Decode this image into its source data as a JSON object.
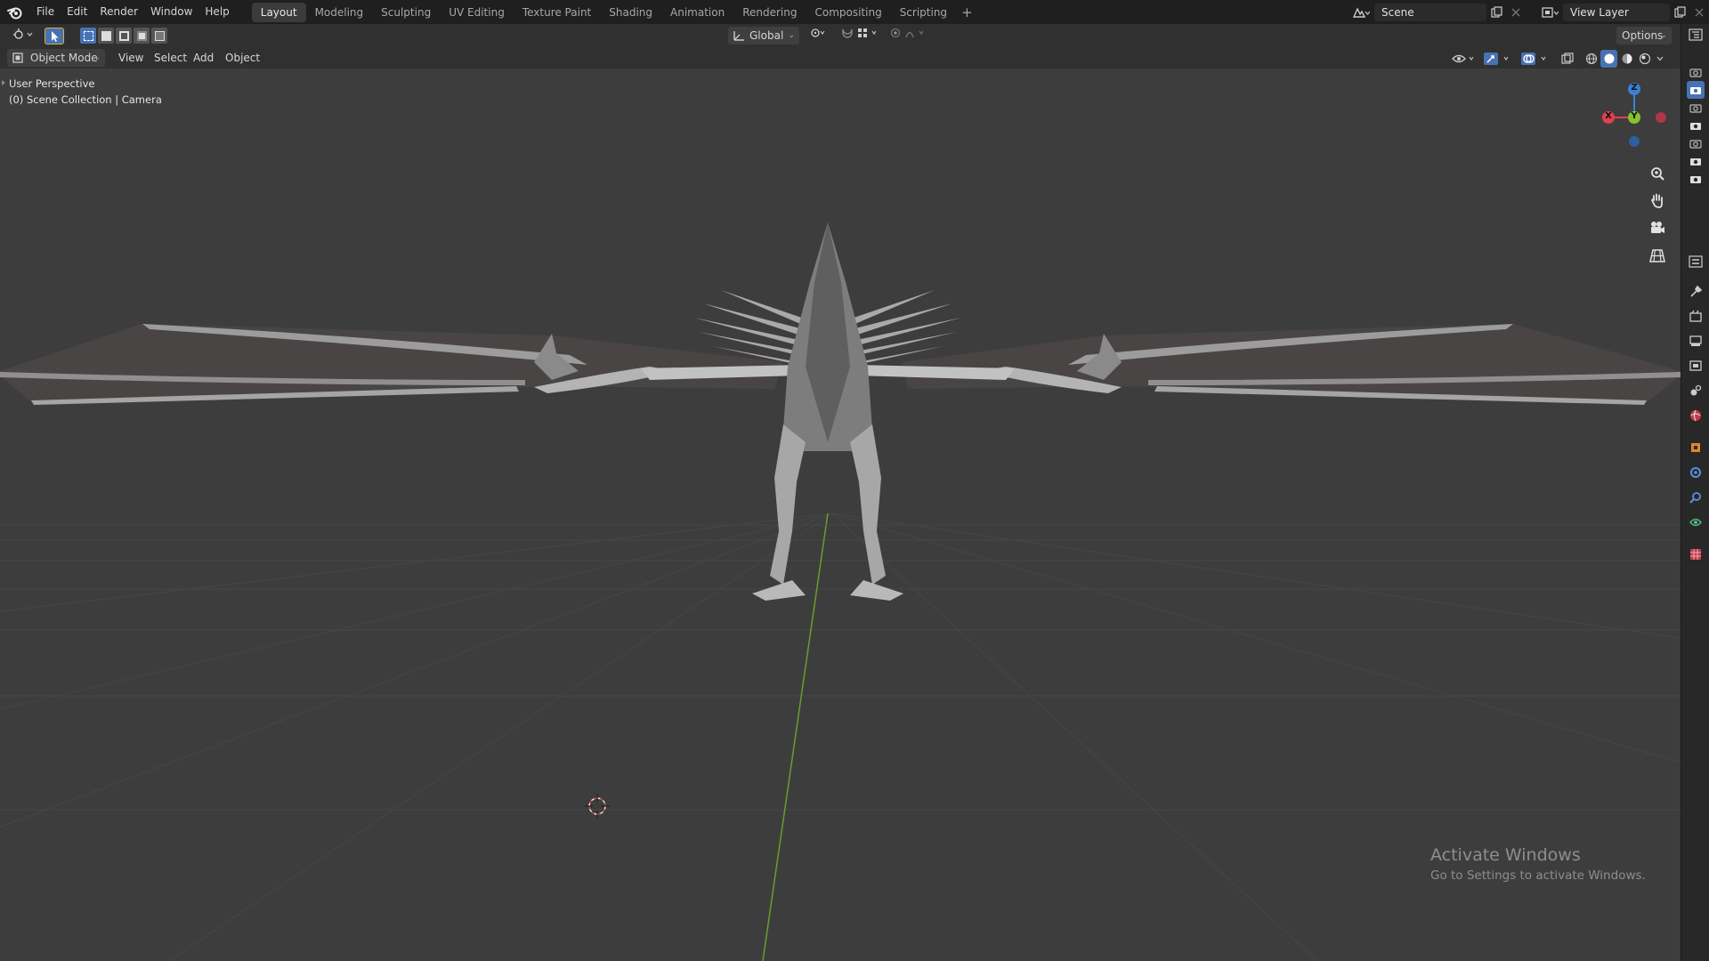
{
  "menubar": {
    "items": [
      "File",
      "Edit",
      "Render",
      "Window",
      "Help"
    ],
    "workspaces": [
      "Layout",
      "Modeling",
      "Sculpting",
      "UV Editing",
      "Texture Paint",
      "Shading",
      "Animation",
      "Rendering",
      "Compositing",
      "Scripting"
    ],
    "active_workspace": "Layout",
    "add_tab": "+",
    "scene_name": "Scene",
    "view_layer_name": "View Layer"
  },
  "toolheader": {
    "transform_orientation": "Global",
    "options_label": "Options"
  },
  "viewheader": {
    "mode": "Object Mode",
    "menus": [
      "View",
      "Select",
      "Add",
      "Object"
    ]
  },
  "viewport": {
    "perspective_label": "User Perspective",
    "collection_label": "(0) Scene Collection | Camera",
    "gizmo_axes": {
      "x": "X",
      "y": "Y",
      "z": "Z"
    }
  },
  "watermark": {
    "title": "Activate Windows",
    "subtitle": "Go to Settings to activate Windows."
  },
  "colors": {
    "axis_x": "#e0404f",
    "axis_y": "#86c22e",
    "axis_z": "#3c7fd8",
    "accent": "#4772b3",
    "viewport_bg": "#3d3d3d"
  }
}
